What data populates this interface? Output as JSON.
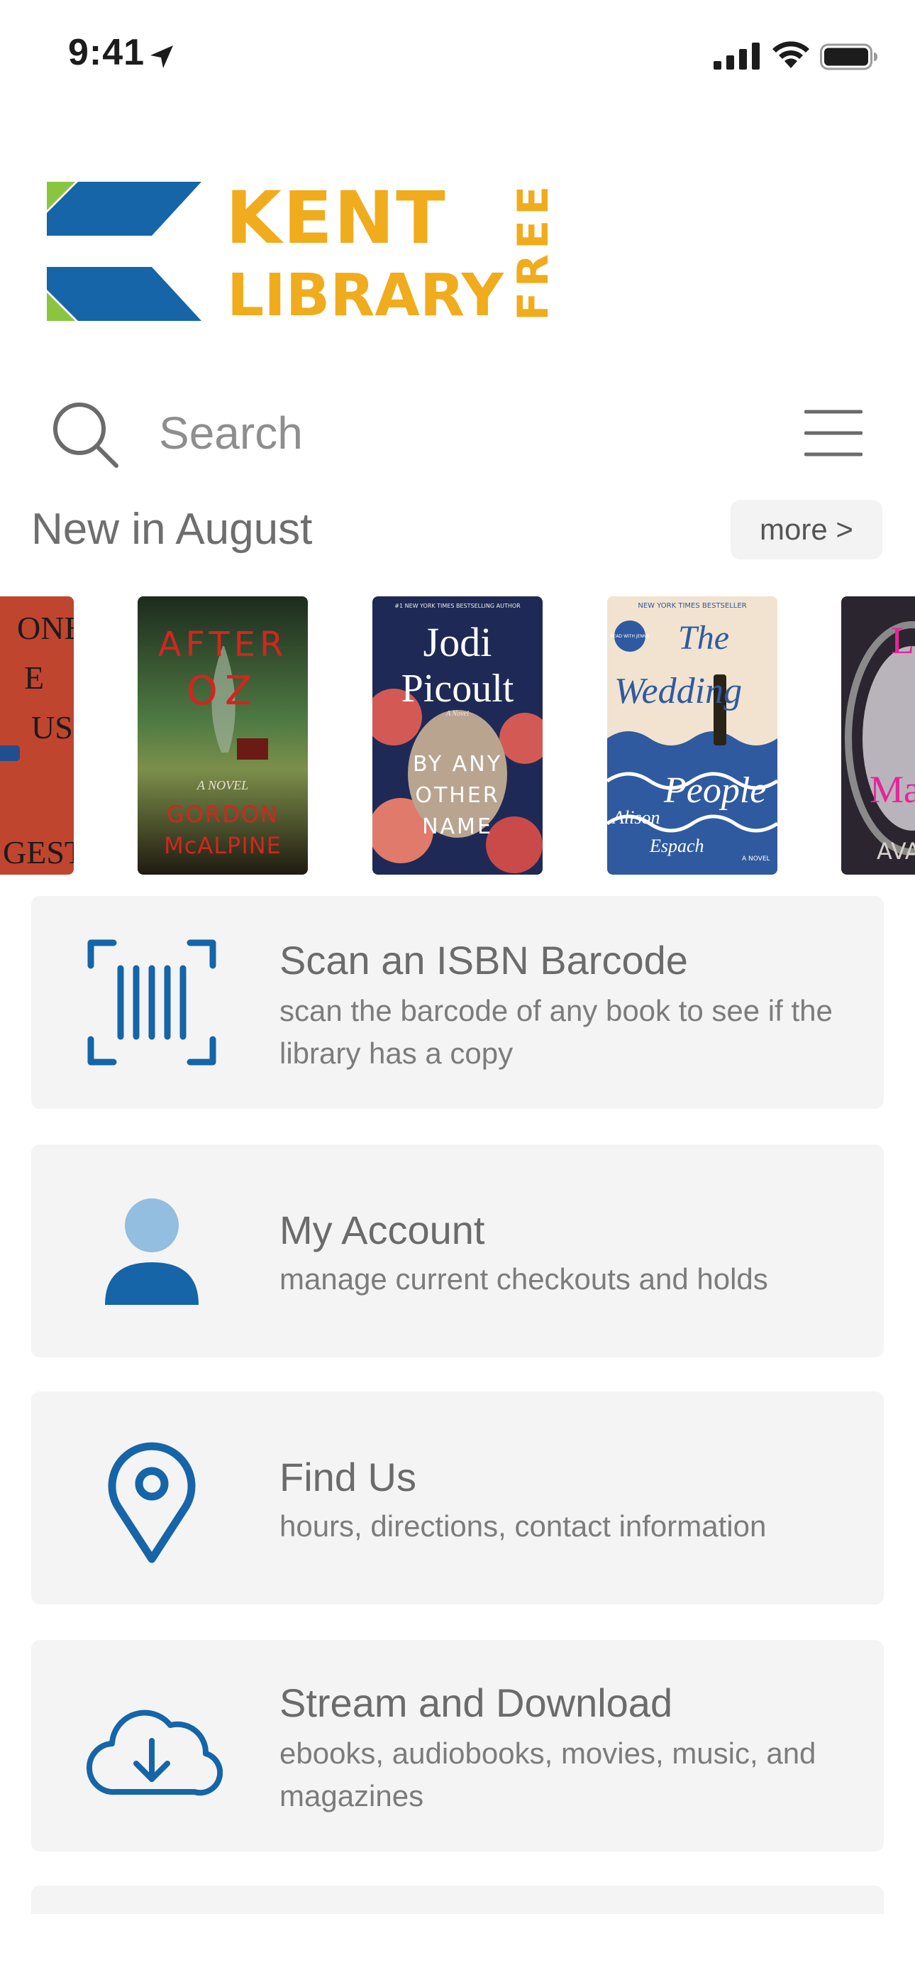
{
  "status_bar": {
    "time": "9:41"
  },
  "logo": {
    "line1": "KENT",
    "line2": "LIBRARY",
    "side": "FREE"
  },
  "search": {
    "placeholder": "Search"
  },
  "section": {
    "title": "New in August",
    "more_label": "more >"
  },
  "books": [
    {
      "title_lines": [
        "ONE",
        "E",
        "US"
      ],
      "author": "GESTU",
      "bg": "#c0452f"
    },
    {
      "title_lines": [
        "AFTER",
        "OZ"
      ],
      "subtitle": "A NOVEL",
      "author_lines": [
        "GORDON",
        "McALPINE"
      ],
      "bg": "#3a5a2a"
    },
    {
      "tagline": "#1 NEW YORK TIMES BESTSELLING AUTHOR",
      "title_lines": [
        "Jodi",
        "Picoult"
      ],
      "subtitle": "A Novel",
      "author_lines": [
        "BY ANY",
        "OTHER",
        "NAME"
      ],
      "bg": "#1e2a55"
    },
    {
      "tagline": "NEW YORK TIMES BESTSELLER",
      "badge": "READ WITH JENNA",
      "title_lines": [
        "The",
        "Wedding",
        "People"
      ],
      "author_lines": [
        "Alison",
        "Espach"
      ],
      "subtitle": "A NOVEL",
      "bg": "#f1e3cf"
    },
    {
      "title_lines": [
        "L",
        "Ma"
      ],
      "author": "AVA",
      "bg": "#2b2530"
    }
  ],
  "cards": [
    {
      "title": "Scan an ISBN Barcode",
      "description": "scan the barcode of any book to see if the library has a copy",
      "icon": "barcode-scan-icon"
    },
    {
      "title": "My Account",
      "description": "manage current checkouts and holds",
      "icon": "person-icon"
    },
    {
      "title": "Find Us",
      "description": "hours, directions, contact information",
      "icon": "map-pin-icon"
    },
    {
      "title": "Stream and Download",
      "description": "ebooks, audiobooks, movies, music, and magazines",
      "icon": "cloud-download-icon"
    }
  ],
  "colors": {
    "brand_blue": "#1565a8",
    "brand_gold": "#f0ac1d",
    "brand_green": "#8bc53f",
    "light_blue": "#93bedf",
    "card_bg": "#f4f4f4"
  }
}
